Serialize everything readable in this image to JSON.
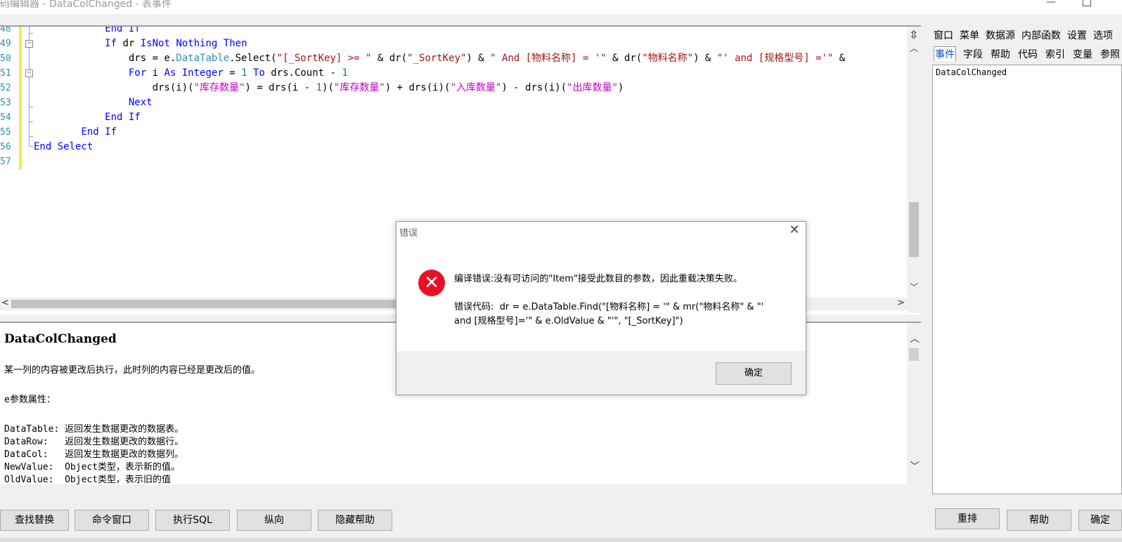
{
  "window": {
    "title": "码编辑器 - DataColChanged - 表事件"
  },
  "editor": {
    "line_numbers": [
      "48",
      "49",
      "50",
      "51",
      "52",
      "53",
      "54",
      "55",
      "56",
      "57"
    ],
    "lines": [
      [
        {
          "t": "            End If",
          "c": "kw"
        }
      ],
      [
        {
          "t": "            ",
          "c": "id"
        },
        {
          "t": "If",
          "c": "kw"
        },
        {
          "t": " dr ",
          "c": "id"
        },
        {
          "t": "IsNot",
          "c": "kw"
        },
        {
          "t": " ",
          "c": "id"
        },
        {
          "t": "Nothing",
          "c": "kw"
        },
        {
          "t": " ",
          "c": "id"
        },
        {
          "t": "Then",
          "c": "kw"
        }
      ],
      [
        {
          "t": "                drs = e.",
          "c": "id"
        },
        {
          "t": "DataTable",
          "c": "ty"
        },
        {
          "t": ".Select(",
          "c": "id"
        },
        {
          "t": "\"[_SortKey] >= \"",
          "c": "str"
        },
        {
          "t": " & dr(",
          "c": "id"
        },
        {
          "t": "\"_SortKey\"",
          "c": "str"
        },
        {
          "t": ") & ",
          "c": "id"
        },
        {
          "t": "\" And [物料名称] = '\"",
          "c": "str"
        },
        {
          "t": " & dr(",
          "c": "id"
        },
        {
          "t": "\"物料名称\"",
          "c": "str"
        },
        {
          "t": ") & ",
          "c": "id"
        },
        {
          "t": "\"' and [规格型号] ='\"",
          "c": "str"
        },
        {
          "t": " &",
          "c": "id"
        }
      ],
      [
        {
          "t": "                ",
          "c": "id"
        },
        {
          "t": "For",
          "c": "kw"
        },
        {
          "t": " i ",
          "c": "id"
        },
        {
          "t": "As",
          "c": "kw"
        },
        {
          "t": " ",
          "c": "id"
        },
        {
          "t": "Integer",
          "c": "kw"
        },
        {
          "t": " = ",
          "c": "id"
        },
        {
          "t": "1",
          "c": "num"
        },
        {
          "t": " ",
          "c": "id"
        },
        {
          "t": "To",
          "c": "kw"
        },
        {
          "t": " drs.Count - ",
          "c": "id"
        },
        {
          "t": "1",
          "c": "num"
        }
      ],
      [
        {
          "t": "                    drs(i)(",
          "c": "id"
        },
        {
          "t": "\"库存数量\"",
          "c": "cn"
        },
        {
          "t": ") = drs(i - ",
          "c": "id"
        },
        {
          "t": "1",
          "c": "num"
        },
        {
          "t": ")(",
          "c": "id"
        },
        {
          "t": "\"库存数量\"",
          "c": "cn"
        },
        {
          "t": ") + drs(i)(",
          "c": "id"
        },
        {
          "t": "\"入库数量\"",
          "c": "cn"
        },
        {
          "t": ") - drs(i)(",
          "c": "id"
        },
        {
          "t": "\"出库数量\"",
          "c": "cn"
        },
        {
          "t": ")",
          "c": "id"
        }
      ],
      [
        {
          "t": "                ",
          "c": "id"
        },
        {
          "t": "Next",
          "c": "kw"
        }
      ],
      [
        {
          "t": "            ",
          "c": "id"
        },
        {
          "t": "End If",
          "c": "kw"
        }
      ],
      [
        {
          "t": "        ",
          "c": "id"
        },
        {
          "t": "End If",
          "c": "kw"
        }
      ],
      [
        {
          "t": "End Select",
          "c": "kw"
        }
      ],
      [
        {
          "t": "",
          "c": "id"
        }
      ]
    ]
  },
  "help": {
    "title": "DataColChanged",
    "lines": [
      "某一列的内容被更改后执行，此时列的内容已经是更改后的值。",
      "e参数属性：",
      "DataTable: 返回发生数据更改的数据表。",
      "DataRow:   返回发生数据更改的数据行。",
      "DataCol:   返回发生数据更改的数据列。",
      "NewValue:  Object类型，表示新的值。",
      "OldValue:  Object类型，表示旧的值"
    ]
  },
  "right_panel": {
    "menu": [
      "窗口",
      "菜单",
      "数据源",
      "内部函数",
      "设置",
      "选项"
    ],
    "tabs": [
      "事件",
      "字段",
      "帮助",
      "代码",
      "索引",
      "变量",
      "参照"
    ],
    "active_tab": "事件",
    "list_item": "DataColChanged"
  },
  "buttons": {
    "find_replace": "查找替换",
    "command_window": "命令窗口",
    "exec_sql": "执行SQL",
    "vertical": "纵向",
    "hide_help": "隐藏帮助",
    "rearrange": "重排",
    "help": "帮助",
    "confirm": "确定"
  },
  "dialog": {
    "title": "错误",
    "message": "编译错误:没有可访问的\"Item\"接受此数目的参数，因此重载决策失败。",
    "code_line1": "错误代码:  dr = e.DataTable.Find(\"[物料名称] = '\" & mr(\"物料名称\" & \"'",
    "code_line2": "and [规格型号]='\" & e.OldValue & \"'\", \"[_SortKey]\")",
    "ok_label": "确定"
  },
  "colors": {
    "keyword": "#0000ff",
    "string": "#a31515",
    "cn_string": "#c800c8",
    "type": "#2b91af",
    "line_number": "#2b91af",
    "error_icon": "#e81123",
    "change_bar": "#f5e94a"
  },
  "icons": {
    "error": "error-x-icon",
    "close": "close-icon"
  }
}
